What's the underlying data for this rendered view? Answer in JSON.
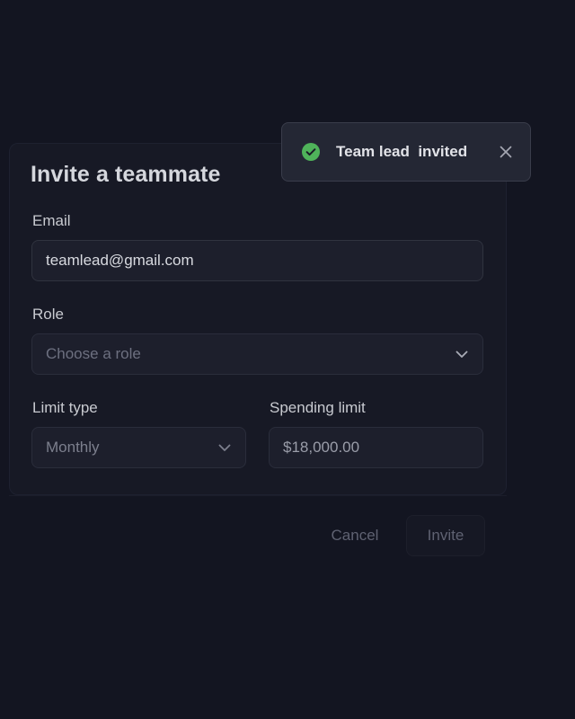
{
  "dialog": {
    "title": "Invite a teammate",
    "email": {
      "label": "Email",
      "value": "teamlead@gmail.com"
    },
    "role": {
      "label": "Role",
      "placeholder": "Choose a role"
    },
    "limit_type": {
      "label": "Limit type",
      "value": "Monthly"
    },
    "spending_limit": {
      "label": "Spending limit",
      "value": "$18,000.00"
    },
    "actions": {
      "cancel_label": "Cancel",
      "invite_label": "Invite"
    }
  },
  "toast": {
    "message": "Team lead  invited",
    "icon": "check-circle-icon",
    "close_icon": "close-icon",
    "status_color": "#4fb35a"
  },
  "colors": {
    "background": "#131521",
    "surface": "#171925",
    "field": "#1d1f2c",
    "toast": "#242734"
  }
}
